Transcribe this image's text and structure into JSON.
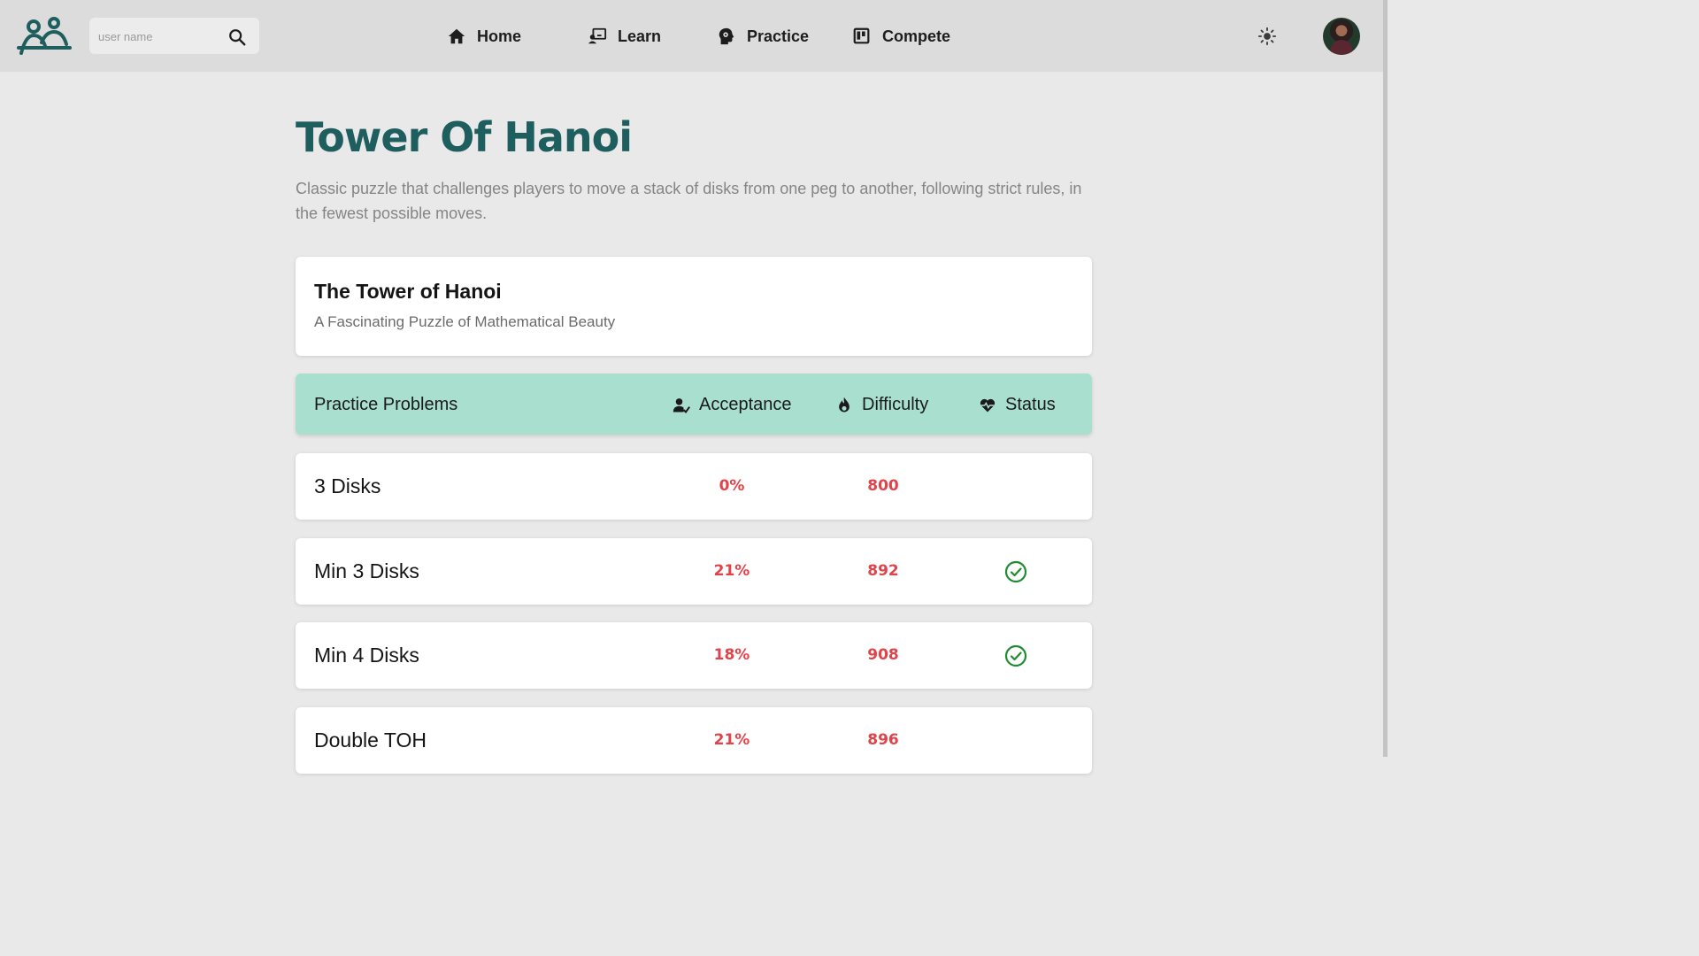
{
  "header": {
    "logo_icon": "people-icon",
    "search": {
      "placeholder": "user name",
      "value": ""
    },
    "nav": [
      {
        "label": "Home",
        "icon": "home-icon"
      },
      {
        "label": "Learn",
        "icon": "teacher-board-icon"
      },
      {
        "label": "Practice",
        "icon": "brain-head-icon"
      },
      {
        "label": "Compete",
        "icon": "board-icon"
      }
    ],
    "theme_icon": "sun-icon"
  },
  "page": {
    "title": "Tower Of Hanoi",
    "description": "Classic puzzle that challenges players to move a stack of disks from one peg to another, following strict rules, in the fewest possible moves."
  },
  "info_card": {
    "title": "The Tower of Hanoi",
    "subtitle": "A Fascinating Puzzle of Mathematical Beauty"
  },
  "table": {
    "headers": {
      "problems": "Practice Problems",
      "acceptance": "Acceptance",
      "difficulty": "Difficulty",
      "status": "Status"
    },
    "rows": [
      {
        "name": "3 Disks",
        "acceptance": "0%",
        "difficulty": "800",
        "solved": false
      },
      {
        "name": "Min 3 Disks",
        "acceptance": "21%",
        "difficulty": "892",
        "solved": true
      },
      {
        "name": "Min 4 Disks",
        "acceptance": "18%",
        "difficulty": "908",
        "solved": true
      },
      {
        "name": "Double TOH",
        "acceptance": "21%",
        "difficulty": "896",
        "solved": false
      }
    ]
  },
  "colors": {
    "title": "#1f5e5e",
    "header_bg": "#a9dfce",
    "metric": "#e0434a",
    "solved": "#1e8c2e"
  }
}
